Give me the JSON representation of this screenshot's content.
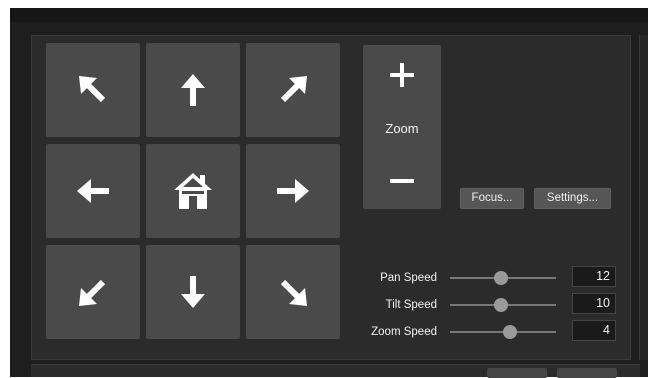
{
  "ptz": {
    "pad": [
      {
        "name": "pan-up-left-button",
        "icon": "arrow-up-left-icon"
      },
      {
        "name": "tilt-up-button",
        "icon": "arrow-up-icon"
      },
      {
        "name": "pan-up-right-button",
        "icon": "arrow-up-right-icon"
      },
      {
        "name": "pan-left-button",
        "icon": "arrow-left-icon"
      },
      {
        "name": "home-button",
        "icon": "home-icon"
      },
      {
        "name": "pan-right-button",
        "icon": "arrow-right-icon"
      },
      {
        "name": "pan-down-left-button",
        "icon": "arrow-down-left-icon"
      },
      {
        "name": "tilt-down-button",
        "icon": "arrow-down-icon"
      },
      {
        "name": "pan-down-right-button",
        "icon": "arrow-down-right-icon"
      }
    ],
    "zoom": {
      "label": "Zoom",
      "in_icon": "plus-icon",
      "out_icon": "minus-icon"
    },
    "focus_button": "Focus...",
    "settings_button": "Settings...",
    "speeds": [
      {
        "label": "Pan Speed",
        "value": "12",
        "fraction": 0.48
      },
      {
        "label": "Tilt Speed",
        "value": "10",
        "fraction": 0.48
      },
      {
        "label": "Zoom Speed",
        "value": "4",
        "fraction": 0.57
      }
    ]
  },
  "colors": {
    "background": "#1e1e1e",
    "panel": "#2b2b2b",
    "button": "#4a4a4a",
    "icon": "#ffffff"
  }
}
